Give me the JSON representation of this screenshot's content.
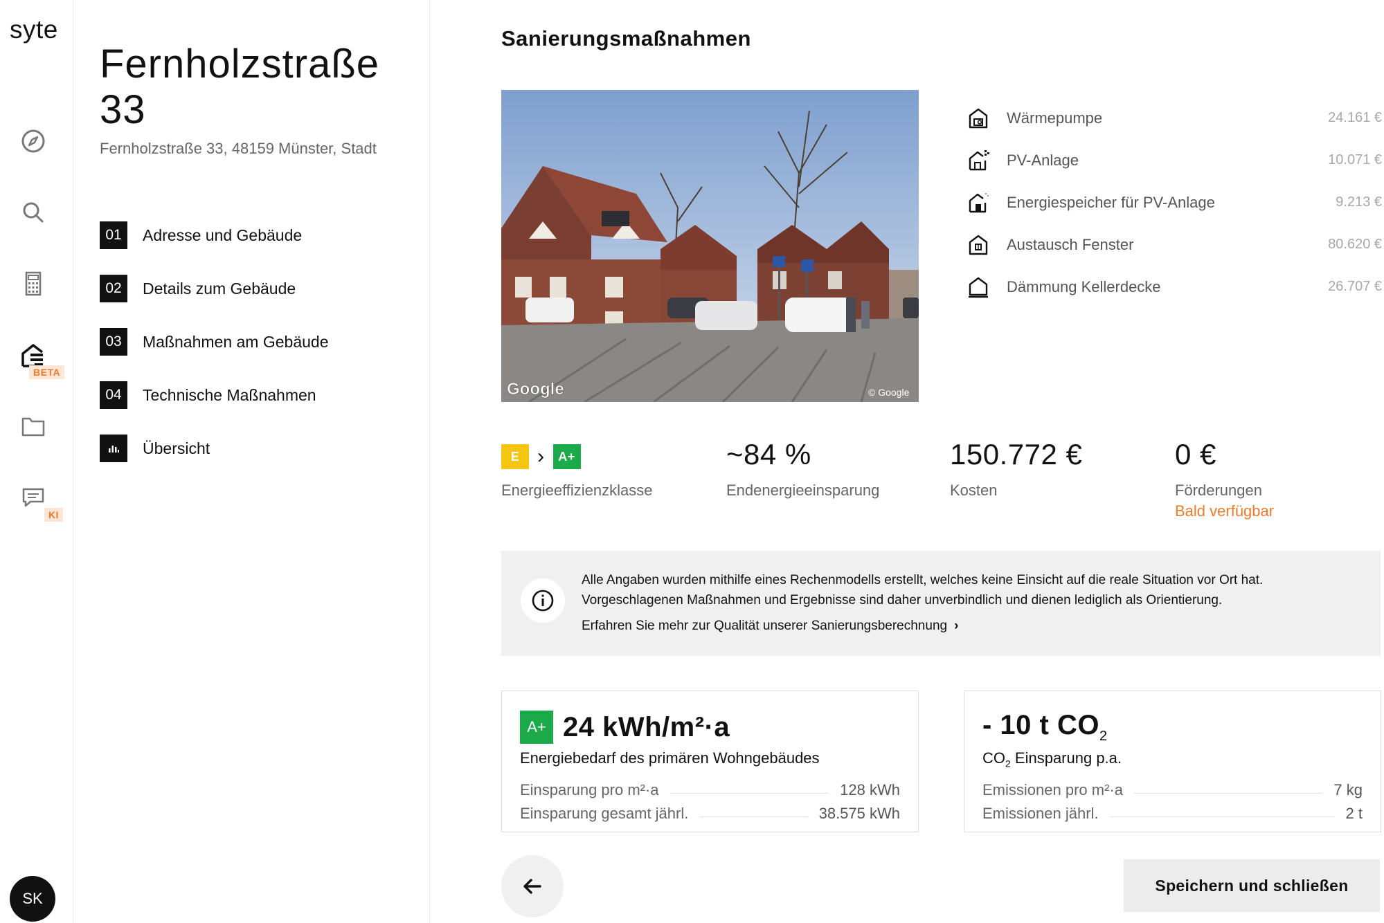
{
  "app": {
    "logo": "syte"
  },
  "rail": {
    "items": [
      {
        "icon": "compass-icon"
      },
      {
        "icon": "search-icon"
      },
      {
        "icon": "calculator-icon"
      },
      {
        "icon": "house-renovation-icon",
        "tag": "BETA"
      },
      {
        "icon": "folder-icon"
      },
      {
        "icon": "chat-icon",
        "tag": "KI"
      }
    ],
    "avatar": "SK"
  },
  "property": {
    "title": "Fernholzstraße 33",
    "subtitle": "Fernholzstraße 33, 48159 Münster, Stadt"
  },
  "steps": [
    {
      "num": "01",
      "label": "Adresse und Gebäude"
    },
    {
      "num": "02",
      "label": "Details zum Gebäude"
    },
    {
      "num": "03",
      "label": "Maßnahmen am Gebäude"
    },
    {
      "num": "04",
      "label": "Technische Maßnahmen"
    },
    {
      "num": "",
      "label": "Übersicht",
      "icon": "bar-chart-icon"
    }
  ],
  "main": {
    "title": "Sanierungsmaßnahmen",
    "photo": {
      "watermark_left": "Google",
      "watermark_right": "© Google"
    },
    "measures": [
      {
        "name": "Wärmepumpe",
        "cost": "24.161 €",
        "icon": "heat-pump-icon"
      },
      {
        "name": "PV-Anlage",
        "cost": "10.071 €",
        "icon": "solar-house-icon"
      },
      {
        "name": "Energiespeicher für PV-Anlage",
        "cost": "9.213 €",
        "icon": "battery-house-icon"
      },
      {
        "name": "Austausch Fenster",
        "cost": "80.620 €",
        "icon": "window-house-icon"
      },
      {
        "name": "Dämmung Kellerdecke",
        "cost": "26.707 €",
        "icon": "insulation-house-icon"
      }
    ],
    "kpis": {
      "class_from": "E",
      "class_to": "A+",
      "class_label": "Energieeffizienzklasse",
      "savings_value": "~84 %",
      "savings_label": "Endenergieeinsparung",
      "cost_value": "150.772 €",
      "cost_label": "Kosten",
      "subsidy_value": "0 €",
      "subsidy_label": "Förderungen",
      "subsidy_note": "Bald verfügbar"
    },
    "info": {
      "text": "Alle Angaben wurden mithilfe eines Rechenmodells erstellt, welches keine Einsicht auf die reale Situation vor Ort hat. Vorgeschlagenen Maßnahmen und Ergebnisse sind daher unverbindlich und dienen lediglich als Orientierung.",
      "link": "Erfahren Sie mehr zur Qualität unserer Sanierungsberechnung"
    },
    "energy_card": {
      "badge": "A+",
      "value": "24 kWh/m²·a",
      "subtitle": "Energiebedarf des primären Wohngebäudes",
      "rows": [
        {
          "label": "Einsparung pro m²·a",
          "value": "128 kWh"
        },
        {
          "label": "Einsparung gesamt jährl.",
          "value": "38.575 kWh"
        }
      ]
    },
    "co2_card": {
      "value": "- 10 t CO",
      "value_sub": "2",
      "subtitle": "CO",
      "subtitle_sub": "2",
      "subtitle_rest": " Einsparung p.a.",
      "rows": [
        {
          "label": "Emissionen pro m²·a",
          "value": "7 kg"
        },
        {
          "label": "Emissionen jährl.",
          "value": "2 t"
        }
      ]
    },
    "actions": {
      "save": "Speichern und schließen"
    }
  },
  "colors": {
    "accent_orange": "#f07a2a",
    "class_e": "#f6c512",
    "class_a_plus": "#1aaa4a"
  }
}
